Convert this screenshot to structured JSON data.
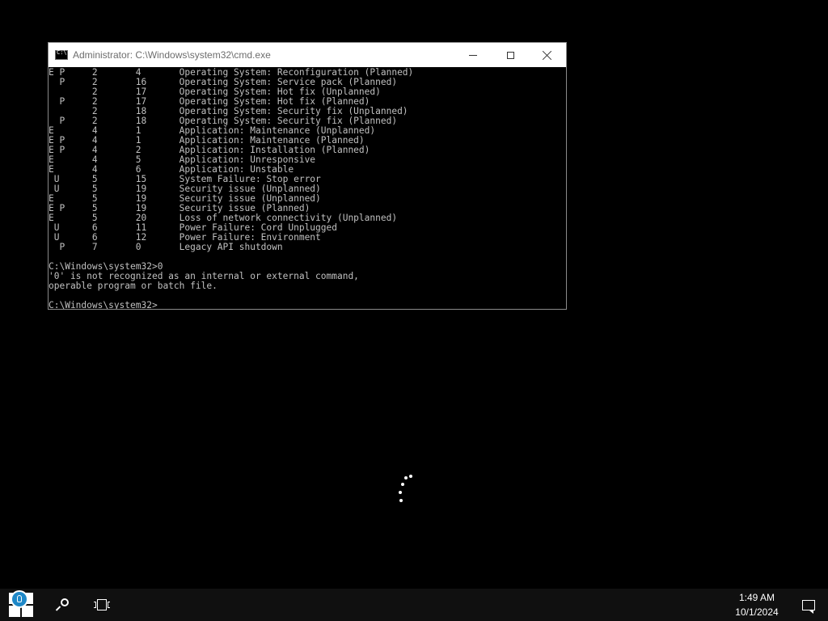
{
  "window": {
    "title": "Administrator: C:\\Windows\\system32\\cmd.exe"
  },
  "console": {
    "text": "E P     2       4       Operating System: Reconfiguration (Planned)\n  P     2       16      Operating System: Service pack (Planned)\n        2       17      Operating System: Hot fix (Unplanned)\n  P     2       17      Operating System: Hot fix (Planned)\n        2       18      Operating System: Security fix (Unplanned)\n  P     2       18      Operating System: Security fix (Planned)\nE       4       1       Application: Maintenance (Unplanned)\nE P     4       1       Application: Maintenance (Planned)\nE P     4       2       Application: Installation (Planned)\nE       4       5       Application: Unresponsive\nE       4       6       Application: Unstable\n U      5       15      System Failure: Stop error\n U      5       19      Security issue (Unplanned)\nE       5       19      Security issue (Unplanned)\nE P     5       19      Security issue (Planned)\nE       5       20      Loss of network connectivity (Unplanned)\n U      6       11      Power Failure: Cord Unplugged\n U      6       12      Power Failure: Environment\n  P     7       0       Legacy API shutdown\n\nC:\\Windows\\system32>0\n'0' is not recognized as an internal or external command,\noperable program or batch file.\n\nC:\\Windows\\system32>"
  },
  "taskbar": {
    "time": "1:49 AM",
    "date": "10/1/2024"
  },
  "icons": {
    "start": "windows-logo-icon",
    "search": "search-icon",
    "task_view": "task-view-icon",
    "notifications": "action-center-icon",
    "cmd": "command-prompt-icon",
    "spinner": "loading-spinner-icon"
  },
  "colors": {
    "desktop": "#000000",
    "console_text": "#c0c0c0",
    "titlebar": "#ffffff",
    "taskbar": "#101010",
    "badge": "#1e88c8"
  }
}
